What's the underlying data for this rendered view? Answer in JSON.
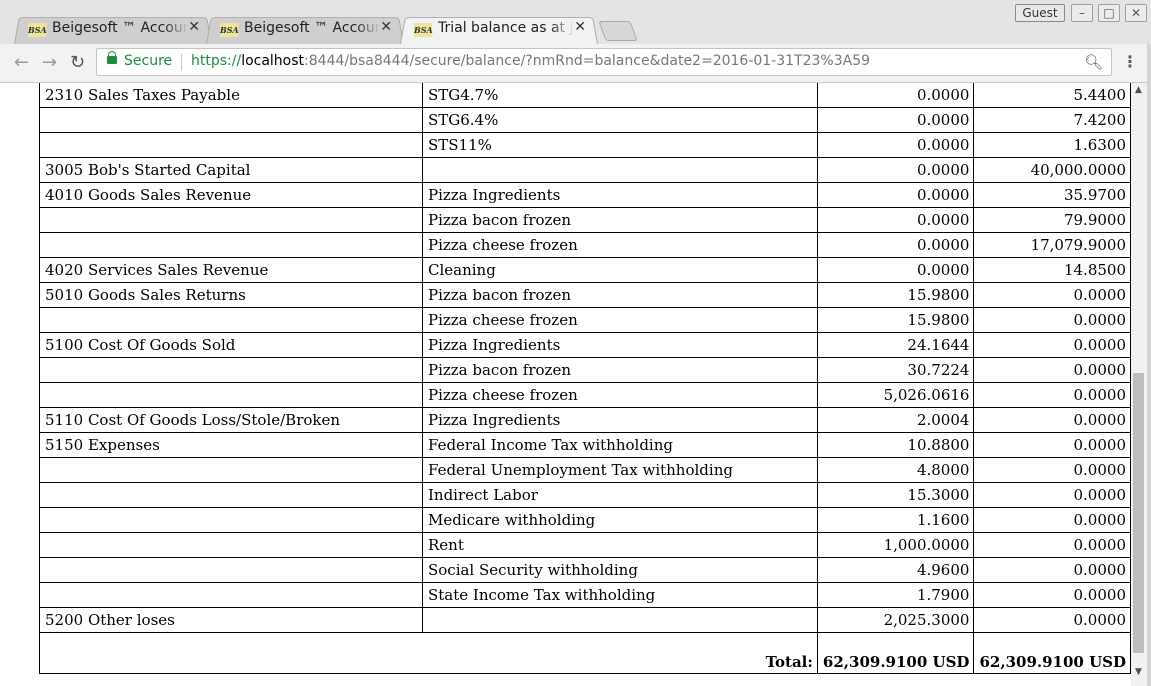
{
  "browser": {
    "tabs": [
      {
        "title": "Beigesoft ™ Accounting",
        "favicon": "BSA"
      },
      {
        "title": "Beigesoft ™ Accounting",
        "favicon": "BSA"
      },
      {
        "title": "Trial balance as at Jan",
        "favicon": "BSA"
      }
    ],
    "profile": "Guest",
    "secure_label": "Secure",
    "url_scheme": "https://",
    "url_host": "localhost",
    "url_rest": ":8444/bsa8444/secure/balance/?nmRnd=balance&date2=2016-01-31T23%3A59",
    "icons": {
      "back": "back-arrow-icon",
      "forward": "forward-arrow-icon",
      "reload": "reload-icon",
      "zoom": "magnifier-icon",
      "menu": "kebab-menu-icon",
      "lock": "lock-icon"
    }
  },
  "trial_balance": {
    "rows": [
      {
        "account": "2310 Sales Taxes Payable",
        "subaccount": "STG4.7%",
        "debit": "0.0000",
        "credit": "5.4400"
      },
      {
        "account": "",
        "subaccount": "STG6.4%",
        "debit": "0.0000",
        "credit": "7.4200"
      },
      {
        "account": "",
        "subaccount": "STS11%",
        "debit": "0.0000",
        "credit": "1.6300"
      },
      {
        "account": "3005 Bob's Started Capital",
        "subaccount": "",
        "debit": "0.0000",
        "credit": "40,000.0000"
      },
      {
        "account": "4010 Goods Sales Revenue",
        "subaccount": "Pizza Ingredients",
        "debit": "0.0000",
        "credit": "35.9700"
      },
      {
        "account": "",
        "subaccount": "Pizza bacon frozen",
        "debit": "0.0000",
        "credit": "79.9000"
      },
      {
        "account": "",
        "subaccount": "Pizza cheese frozen",
        "debit": "0.0000",
        "credit": "17,079.9000"
      },
      {
        "account": "4020 Services Sales Revenue",
        "subaccount": "Cleaning",
        "debit": "0.0000",
        "credit": "14.8500"
      },
      {
        "account": "5010 Goods Sales Returns",
        "subaccount": "Pizza bacon frozen",
        "debit": "15.9800",
        "credit": "0.0000"
      },
      {
        "account": "",
        "subaccount": "Pizza cheese frozen",
        "debit": "15.9800",
        "credit": "0.0000"
      },
      {
        "account": "5100 Cost Of Goods Sold",
        "subaccount": "Pizza Ingredients",
        "debit": "24.1644",
        "credit": "0.0000"
      },
      {
        "account": "",
        "subaccount": "Pizza bacon frozen",
        "debit": "30.7224",
        "credit": "0.0000"
      },
      {
        "account": "",
        "subaccount": "Pizza cheese frozen",
        "debit": "5,026.0616",
        "credit": "0.0000"
      },
      {
        "account": "5110 Cost Of Goods Loss/Stole/Broken",
        "subaccount": "Pizza Ingredients",
        "debit": "2.0004",
        "credit": "0.0000"
      },
      {
        "account": "5150 Expenses",
        "subaccount": "Federal Income Tax withholding",
        "debit": "10.8800",
        "credit": "0.0000"
      },
      {
        "account": "",
        "subaccount": "Federal Unemployment Tax withholding",
        "debit": "4.8000",
        "credit": "0.0000"
      },
      {
        "account": "",
        "subaccount": "Indirect Labor",
        "debit": "15.3000",
        "credit": "0.0000"
      },
      {
        "account": "",
        "subaccount": "Medicare withholding",
        "debit": "1.1600",
        "credit": "0.0000"
      },
      {
        "account": "",
        "subaccount": "Rent",
        "debit": "1,000.0000",
        "credit": "0.0000"
      },
      {
        "account": "",
        "subaccount": "Social Security withholding",
        "debit": "4.9600",
        "credit": "0.0000"
      },
      {
        "account": "",
        "subaccount": "State Income Tax withholding",
        "debit": "1.7900",
        "credit": "0.0000"
      }
    ],
    "last_row": {
      "account": "5200 Other loses",
      "subaccount": "",
      "debit": "2,025.3000",
      "credit": "0.0000"
    },
    "total": {
      "label": "Total:",
      "debit": "62,309.9100 USD",
      "credit": "62,309.9100 USD"
    }
  }
}
